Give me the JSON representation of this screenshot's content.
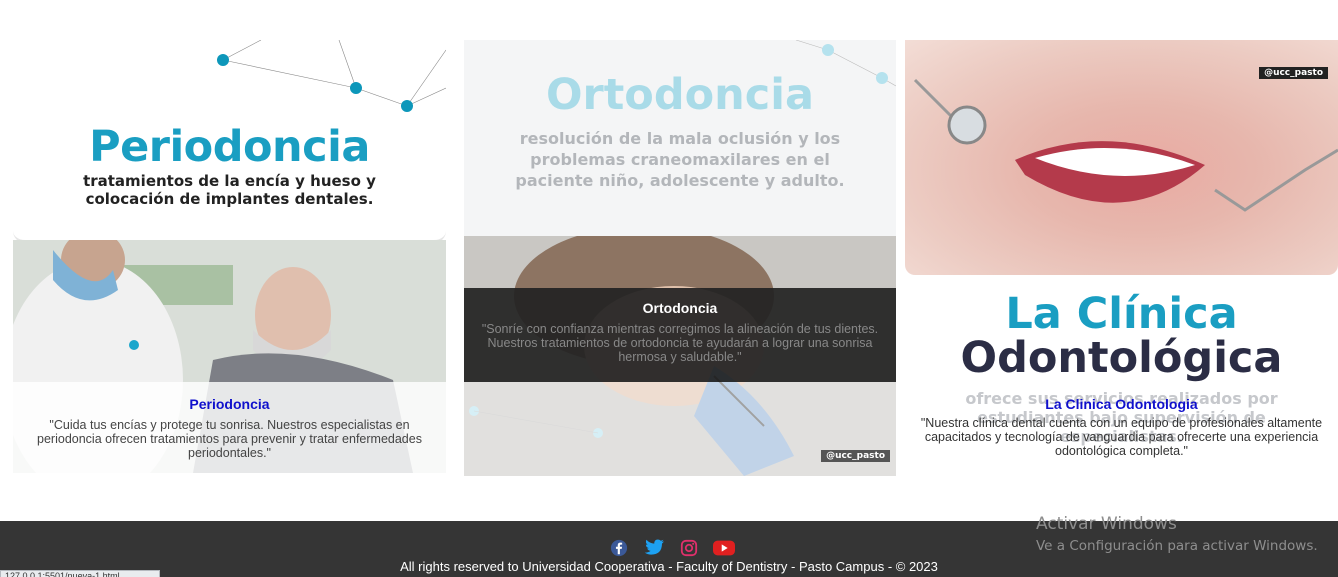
{
  "cards": {
    "periodoncia": {
      "brand_title": "Periodoncia",
      "brand_sub": "tratamientos de la encía y hueso y colocación de implantes dentales.",
      "title": "Periodoncia",
      "text": "\"Cuida tus encías y protege tu sonrisa. Nuestros especialistas en periodoncia ofrecen tratamientos para prevenir y tratar enfermedades periodontales.\""
    },
    "ortodoncia": {
      "brand_title": "Ortodoncia",
      "brand_sub": "resolución de la mala oclusión y los problemas craneomaxilares en el paciente niño, adolescente y adulto.",
      "title": "Ortodoncia",
      "text": "\"Sonríe con confianza mientras corregimos la alineación de tus dientes. Nuestros tratamientos de ortodoncia te ayudarán a lograr una sonrisa hermosa y saludable.\"",
      "tag": "@ucc_pasto"
    },
    "clinica": {
      "brand_title_1": "La Clínica",
      "brand_title_2": "Odontológica",
      "brand_sub": "ofrece sus servicios realizados por estudiantes bajo supervisión de especialistas.",
      "title": "La Clinica Odontologia",
      "text": "\"Nuestra clínica dental cuenta con un equipo de profesionales altamente capacitados y tecnología de vanguardia para ofrecerte una experiencia odontológica completa.\"",
      "tag": "@ucc_pasto"
    }
  },
  "footer": {
    "social": [
      "facebook-icon",
      "twitter-icon",
      "instagram-icon",
      "youtube-icon"
    ],
    "copyright": "All rights reserved to Universidad Cooperativa - Faculty of Dentistry - Pasto Campus - © 2023"
  },
  "windows_watermark": {
    "line1": "Activar Windows",
    "line2": "Ve a Configuración para activar Windows."
  },
  "status_bar": "127.0.0.1:5501/nueva-1.html",
  "colors": {
    "accent_cyan": "#1a9ec2",
    "link_blue": "#1010cc",
    "footer_bg": "#353535"
  }
}
